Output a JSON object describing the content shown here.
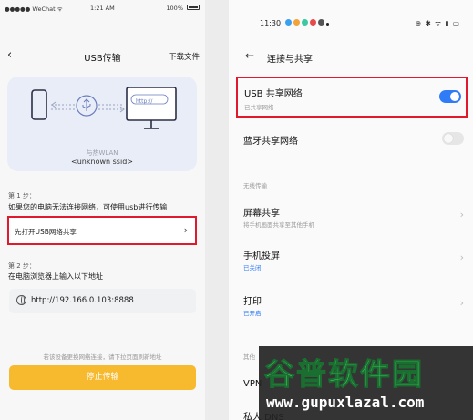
{
  "left": {
    "status": {
      "carrier": "●●●●● WeChat ᯤ",
      "time": "1:21 AM",
      "battery": "100%"
    },
    "nav": {
      "back": "‹",
      "title": "USB传输",
      "download": "下载文件"
    },
    "diagram": {
      "url": "http://",
      "hotspot": "与热WLAN",
      "ssid": "<unknown ssid>"
    },
    "step1": {
      "label": "第 1 步：",
      "desc": "如果您的电脑无法连接网络，可使用usb进行传输",
      "action": "先打开USB网络共享",
      "chevron": "›"
    },
    "step2": {
      "label": "第 2 步：",
      "desc": "在电脑浏览器上输入以下地址",
      "address": "http://192.166.0.103:8888"
    },
    "hint": "若该设备更换网络连接，请下拉页面刷新地址",
    "stop_button": "停止传输"
  },
  "right": {
    "status": {
      "time": "11:30",
      "right_icons": "⊕ ✱ ᯤ ▮ ▭"
    },
    "header": {
      "back": "←",
      "title": "连接与共享"
    },
    "usb_share": {
      "name": "USB 共享网络",
      "sub": "已共享网络",
      "enabled": true
    },
    "bt_share": {
      "name": "蓝牙共享网络",
      "enabled": false
    },
    "wireless_label": "无线传输",
    "screen_share": {
      "name": "屏幕共享",
      "sub": "将手机画面共享至其他手机",
      "chevron": "›"
    },
    "cast": {
      "name": "手机投屏",
      "sub": "已关闭",
      "chevron": "›"
    },
    "print": {
      "name": "打印",
      "sub": "已开启",
      "chevron": "›"
    },
    "other_label": "其他",
    "vpn": {
      "name": "VPN"
    },
    "dns": {
      "name": "私人 DNS"
    }
  },
  "watermark": {
    "logo": "谷普软件园",
    "domain": "www.gupuxlazal.com"
  },
  "colors": {
    "accent_blue": "#2f7cf6",
    "highlight_red": "#e1192c",
    "button_yellow": "#f7b92e"
  }
}
